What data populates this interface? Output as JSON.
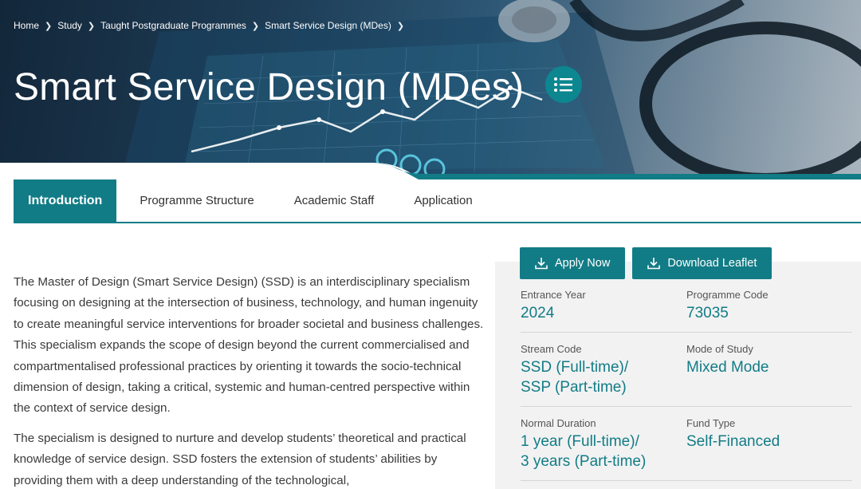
{
  "breadcrumb": [
    {
      "label": "Home"
    },
    {
      "label": "Study"
    },
    {
      "label": "Taught Postgraduate Programmes"
    },
    {
      "label": "Smart Service Design (MDes)"
    }
  ],
  "hero": {
    "title": "Smart Service Design (MDes)",
    "toc_icon": "list-icon"
  },
  "tabs": [
    {
      "label": "Introduction",
      "active": true
    },
    {
      "label": "Programme Structure",
      "active": false
    },
    {
      "label": "Academic Staff",
      "active": false
    },
    {
      "label": "Application",
      "active": false
    }
  ],
  "intro": {
    "paragraphs": [
      "The Master of Design (Smart Service Design) (SSD) is an interdisciplinary specialism focusing on designing at the intersection of business, technology, and human ingenuity to create meaningful service interventions for broader societal and business challenges. This specialism expands the scope of design beyond the current commercialised and compartmentalised professional practices by orienting it towards the socio-technical dimension of design, taking a critical, systemic and human-centred perspective within the context of service design.",
      "The specialism is designed to nurture and develop students’ theoretical and practical knowledge of service design. SSD fosters the extension of students’ abilities by providing them with a deep understanding of the technological,"
    ]
  },
  "actions": {
    "apply_label": "Apply Now",
    "leaflet_label": "Download Leaflet",
    "icon": "download-icon"
  },
  "info": {
    "entrance_year_label": "Entrance Year",
    "entrance_year": "2024",
    "programme_code_label": "Programme Code",
    "programme_code": "73035",
    "stream_code_label": "Stream Code",
    "stream_code_line1": "SSD (Full-time)/",
    "stream_code_line2": "SSP (Part-time)",
    "mode_label": "Mode of Study",
    "mode": "Mixed Mode",
    "duration_label": "Normal Duration",
    "duration_line1": "1 year (Full-time)/",
    "duration_line2": "3 years (Part-time)",
    "fund_label": "Fund Type",
    "fund": "Self-Financed"
  },
  "colors": {
    "accent": "#127c86",
    "panel_bg": "#f2f2f2"
  }
}
